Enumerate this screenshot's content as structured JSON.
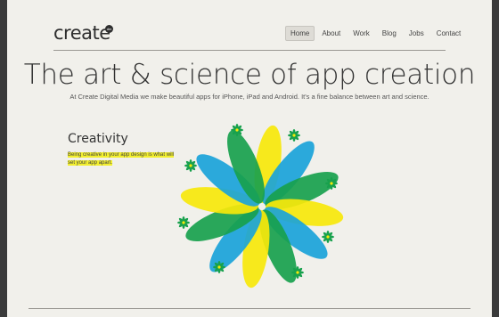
{
  "logo": {
    "text": "create",
    "badge": "dm"
  },
  "nav": {
    "items": [
      {
        "label": "Home",
        "active": true
      },
      {
        "label": "About",
        "active": false
      },
      {
        "label": "Work",
        "active": false
      },
      {
        "label": "Blog",
        "active": false
      },
      {
        "label": "Jobs",
        "active": false
      },
      {
        "label": "Contact",
        "active": false
      }
    ]
  },
  "hero": {
    "headline": "The art & science of app creation",
    "subhead": "At Create Digital Media we make beautiful apps for iPhone, iPad and Android. It's a fine balance between art and science."
  },
  "feature": {
    "title": "Creativity",
    "blurb": "Being creative in your app design is what will set your app apart."
  },
  "colors": {
    "background": "#f1f0eb",
    "frame": "#3a3a3a",
    "yellow": "#f7e80a",
    "blue": "#1aa3d9",
    "green": "#18a14d"
  }
}
